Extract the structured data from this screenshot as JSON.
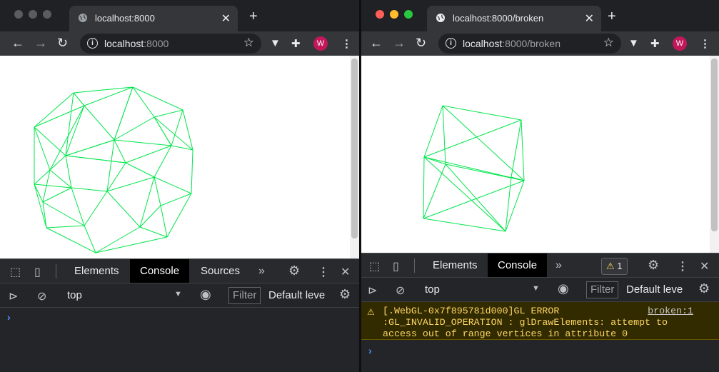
{
  "colors": {
    "wire": "#00e64a",
    "accent": "#4d8eff",
    "warning": "#fdd663"
  },
  "left": {
    "tab_title": "localhost:8000",
    "url_host": "localhost",
    "url_rest": ":8000",
    "avatar_letter": "W",
    "devtools_tabs": [
      "Elements",
      "Console",
      "Sources"
    ],
    "context": "top",
    "filter_placeholder": "Filter",
    "levels": "Default leve"
  },
  "right": {
    "tab_title": "localhost:8000/broken",
    "url_host": "localhost",
    "url_rest": ":8000/broken",
    "avatar_letter": "W",
    "devtools_tabs": [
      "Elements",
      "Console"
    ],
    "issue_count": "1",
    "context": "top",
    "filter_placeholder": "Filter",
    "levels": "Default leve",
    "warning_message": "[.WebGL-0x7f895781d000]GL ERROR\n:GL_INVALID_OPERATION : glDrawElements: attempt to\naccess out of range vertices in attribute 0",
    "warning_source": "broken:1"
  }
}
